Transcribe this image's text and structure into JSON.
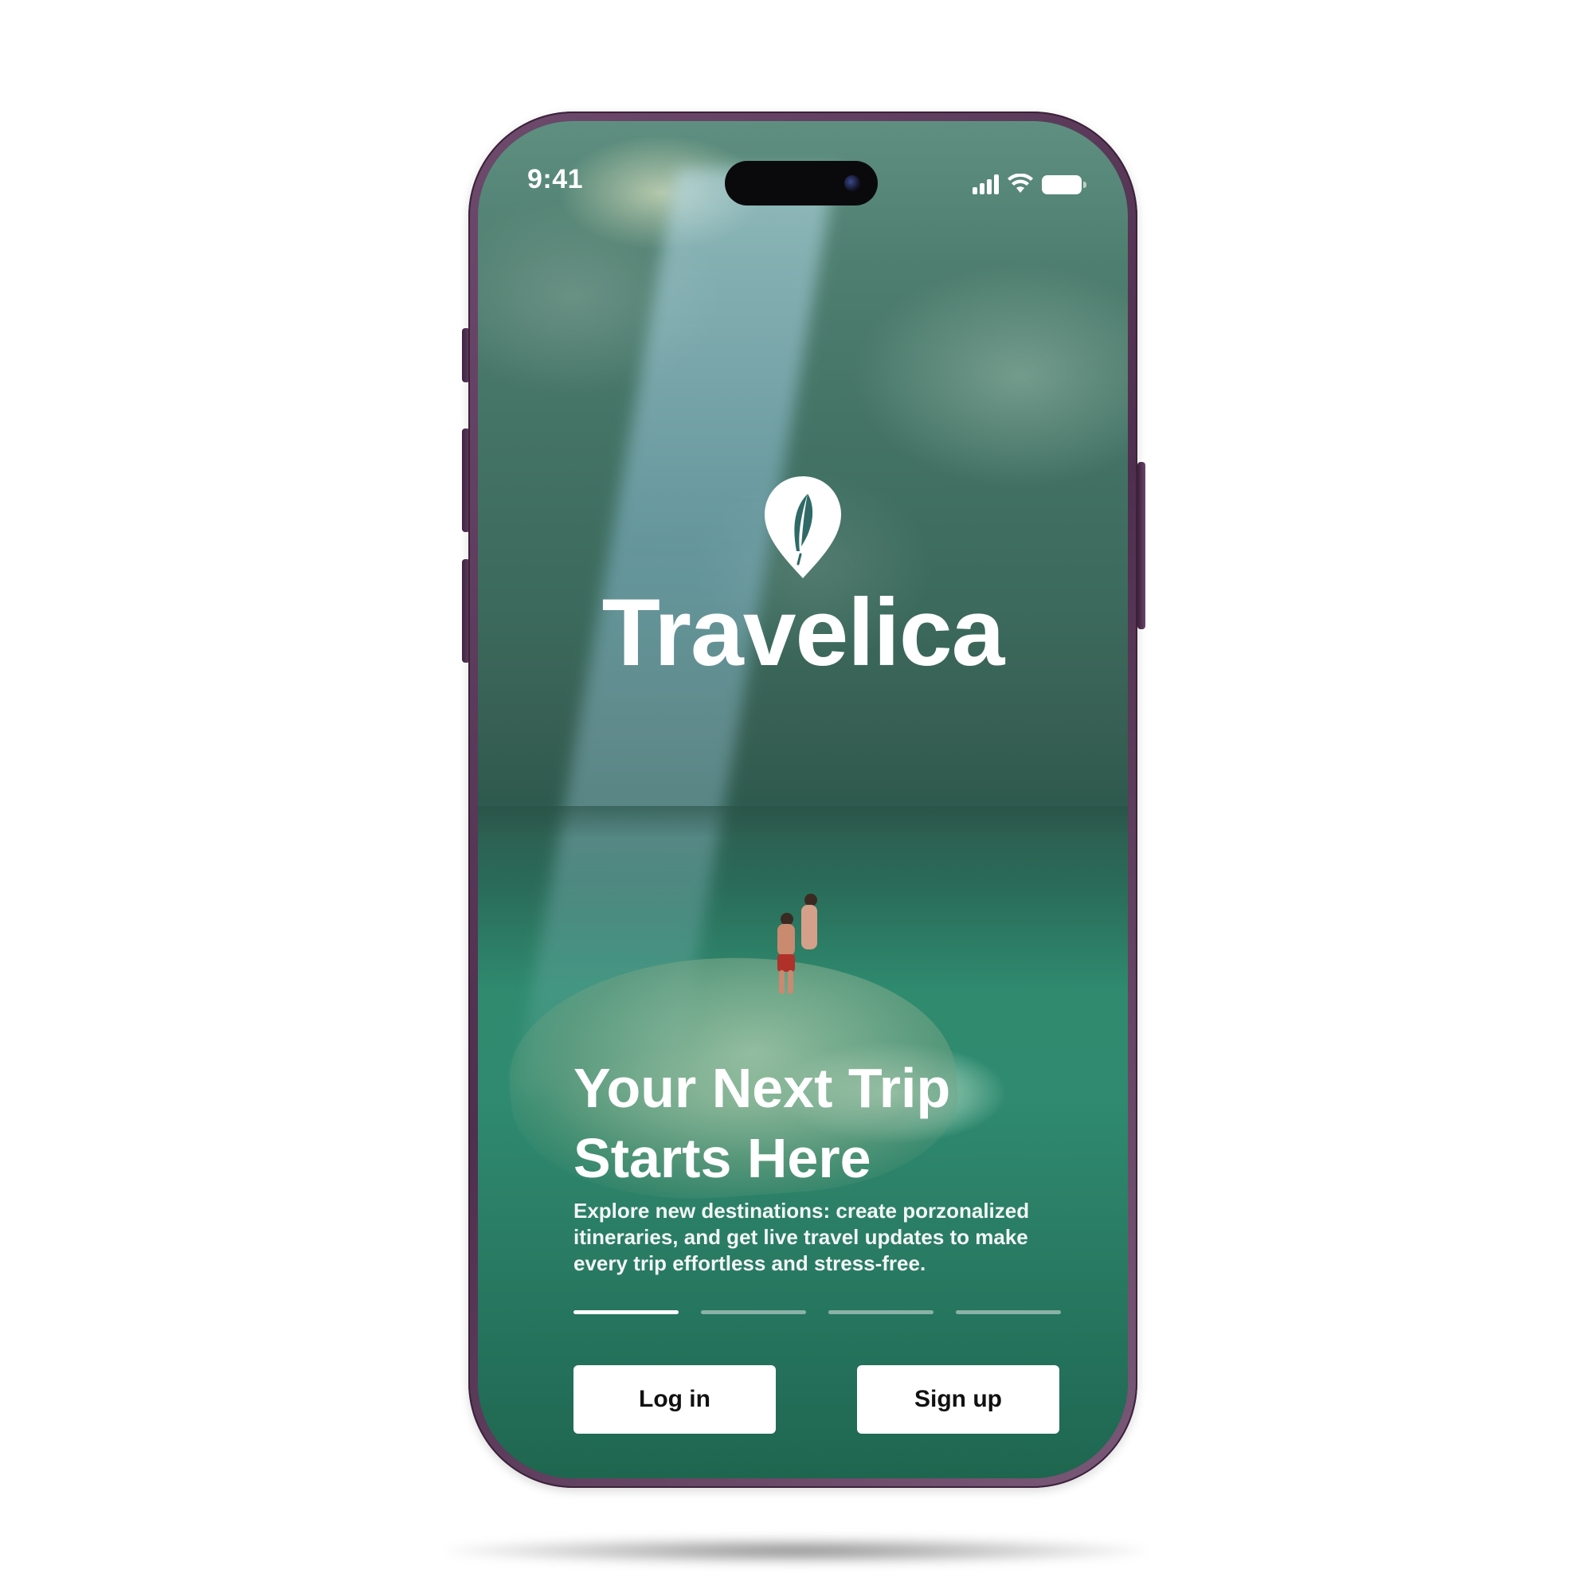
{
  "status_bar": {
    "time": "9:41",
    "icons": [
      "cellular-signal-icon",
      "wifi-icon",
      "battery-icon"
    ]
  },
  "brand": {
    "name": "Travelica",
    "logo_icon": "feather-pin-icon"
  },
  "onboarding": {
    "headline_lines": [
      "Your Next Trip",
      "Starts Here"
    ],
    "description_lines": [
      "Explore new destinations: create porzonalized",
      "itineraries, and get live travel updates to make",
      "every trip effortless and stress-free."
    ],
    "pager": {
      "total": 4,
      "active_index": 0
    }
  },
  "actions": {
    "login_label": "Log in",
    "signup_label": "Sign up"
  },
  "colors": {
    "phone_frame": "#5a3a59",
    "overlay_green": "#2f8a6e",
    "button_bg": "#ffffff",
    "button_text": "#111111"
  }
}
